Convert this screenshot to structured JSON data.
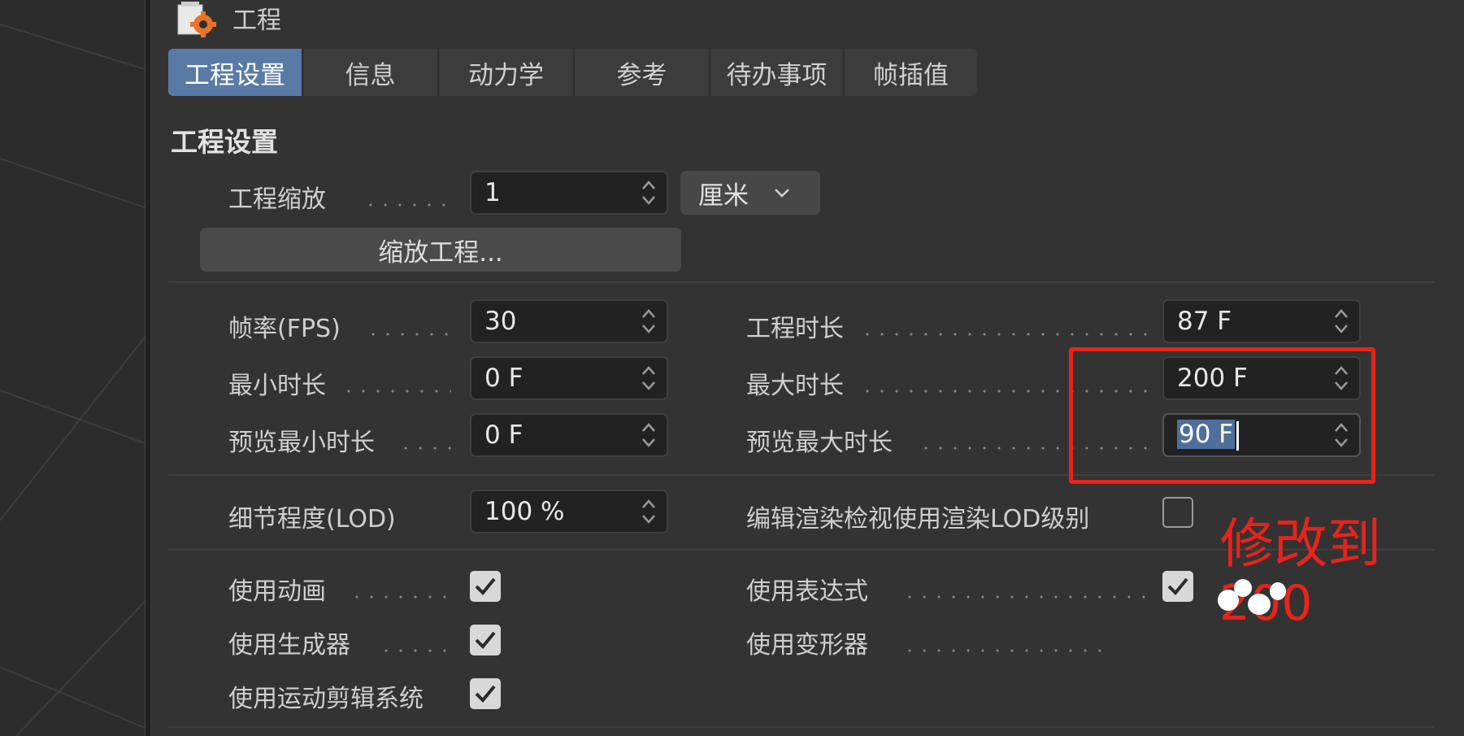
{
  "window": {
    "title": "工程",
    "icon": "settings-gear-icon"
  },
  "tabs": [
    {
      "label": "工程设置",
      "active": true
    },
    {
      "label": "信息",
      "active": false
    },
    {
      "label": "动力学",
      "active": false
    },
    {
      "label": "参考",
      "active": false
    },
    {
      "label": "待办事项",
      "active": false
    },
    {
      "label": "帧插值",
      "active": false
    }
  ],
  "section": {
    "title": "工程设置"
  },
  "project_scale": {
    "label": "工程缩放",
    "value": "1",
    "unit": "厘米"
  },
  "scale_button": {
    "label": "缩放工程..."
  },
  "fps": {
    "label": "帧率(FPS)",
    "value": "30"
  },
  "project_length": {
    "label": "工程时长",
    "value": "87 F"
  },
  "min_time": {
    "label": "最小时长",
    "value": "0 F"
  },
  "max_time": {
    "label": "最大时长",
    "value": "200 F"
  },
  "preview_min": {
    "label": "预览最小时长",
    "value": "0 F"
  },
  "preview_max": {
    "label": "预览最大时长",
    "value": "90 F"
  },
  "lod": {
    "label": "细节程度(LOD)",
    "value": "100 %"
  },
  "render_lod": {
    "label": "编辑渲染检视使用渲染LOD级别",
    "checked": false
  },
  "use_animation": {
    "label": "使用动画",
    "checked": true
  },
  "use_expressions": {
    "label": "使用表达式",
    "checked": true
  },
  "use_generators": {
    "label": "使用生成器",
    "checked": true
  },
  "use_deformers": {
    "label": "使用变形器",
    "checked": false
  },
  "use_motion_system": {
    "label": "使用运动剪辑系统",
    "checked": true
  },
  "annotation": {
    "text": "修改到",
    "text2": "200",
    "color": "#e8231c"
  },
  "colors": {
    "active_tab": "#5a7aa6",
    "panel_bg": "#333333",
    "field_bg": "#222222"
  }
}
